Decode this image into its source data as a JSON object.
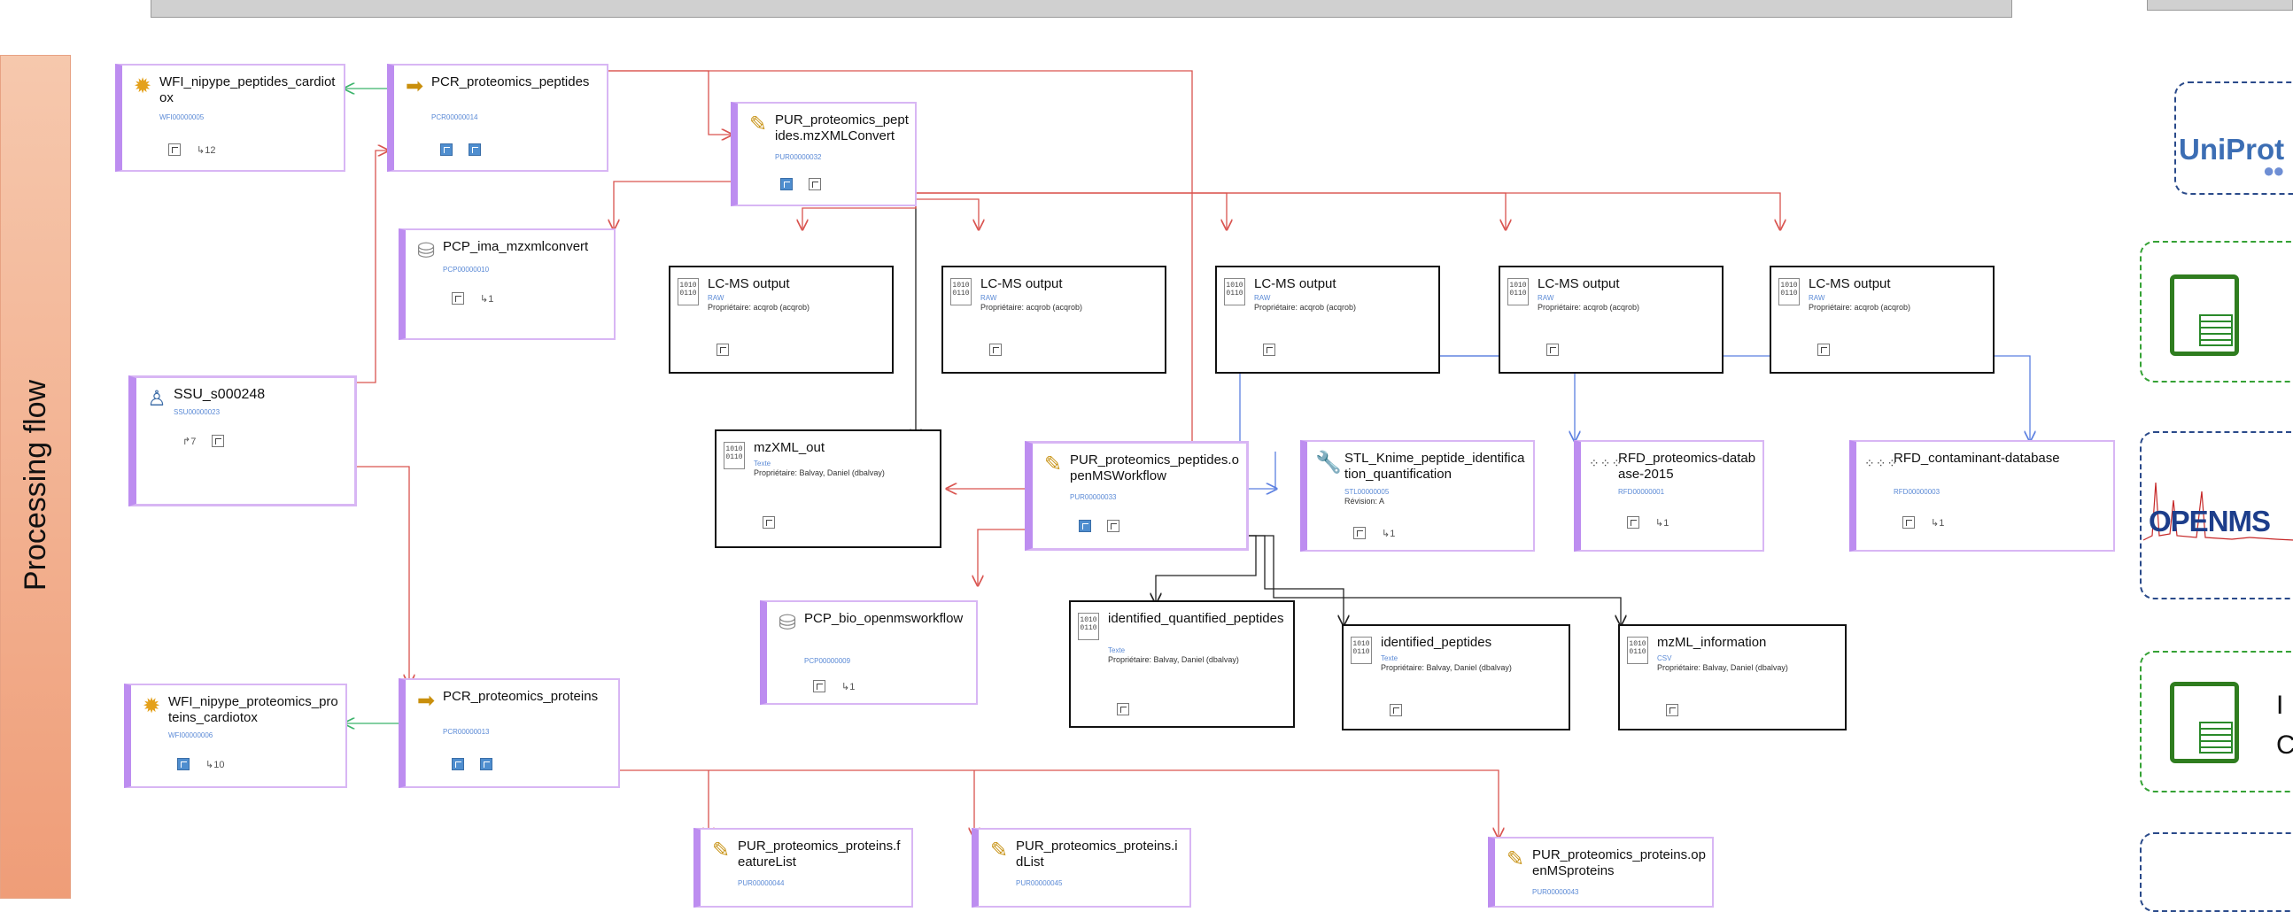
{
  "side_label": "Processing flow",
  "nodes": {
    "wfi_peptides": {
      "title": "WFI_nipype_peptides_cardiotox",
      "code": "WFI00000005",
      "count": "12"
    },
    "pcr_peptides": {
      "title": "PCR_proteomics_peptides",
      "code": "PCR00000014"
    },
    "pur_mzxml": {
      "title": "PUR_proteomics_peptides.mzXMLConvert",
      "code": "PUR00000032"
    },
    "pcp_ima": {
      "title": "PCP_ima_mzxmlconvert",
      "code": "PCP00000010",
      "count": "1"
    },
    "lcms1": {
      "title": "LC-MS output",
      "type": "RAW",
      "owner": "Propriétaire: acqrob (acqrob)"
    },
    "lcms2": {
      "title": "LC-MS output",
      "type": "RAW",
      "owner": "Propriétaire: acqrob (acqrob)"
    },
    "lcms3": {
      "title": "LC-MS output",
      "type": "RAW",
      "owner": "Propriétaire: acqrob (acqrob)"
    },
    "lcms4": {
      "title": "LC-MS output",
      "type": "RAW",
      "owner": "Propriétaire: acqrob (acqrob)"
    },
    "lcms5": {
      "title": "LC-MS output",
      "type": "RAW",
      "owner": "Propriétaire: acqrob (acqrob)"
    },
    "ssu": {
      "title": "SSU_s000248",
      "code": "SSU00000023",
      "count": "7"
    },
    "mzxml_out": {
      "title": "mzXML_out",
      "type": "Texte",
      "owner": "Propriétaire: Balvay, Daniel (dbalvay)"
    },
    "pur_openms": {
      "title": "PUR_proteomics_peptides.openMSWorkflow",
      "code": "PUR00000033"
    },
    "stl_knime": {
      "title": "STL_Knime_peptide_identification_quantification",
      "code": "STL00000005",
      "revision": "Révision: A",
      "count": "1"
    },
    "rfd_db2015": {
      "title": "RFD_proteomics-database-2015",
      "code": "RFD00000001",
      "count": "1"
    },
    "rfd_contam": {
      "title": "RFD_contaminant-database",
      "code": "RFD00000003",
      "count": "1"
    },
    "pcp_bio": {
      "title": "PCP_bio_openmsworkflow",
      "code": "PCP00000009",
      "count": "1"
    },
    "identified_quant": {
      "title": "identified_quantified_peptides",
      "type": "Texte",
      "owner": "Propriétaire: Balvay, Daniel (dbalvay)"
    },
    "identified_pep": {
      "title": "identified_peptides",
      "type": "Texte",
      "owner": "Propriétaire: Balvay, Daniel (dbalvay)"
    },
    "mzml_info": {
      "title": "mzML_information",
      "type": "CSV",
      "owner": "Propriétaire: Balvay, Daniel (dbalvay)"
    },
    "wfi_proteins": {
      "title": "WFI_nipype_proteomics_proteins_cardiotox",
      "code": "WFI00000006",
      "count": "10"
    },
    "pcr_proteins": {
      "title": "PCR_proteomics_proteins",
      "code": "PCR00000013"
    },
    "pur_featurelist": {
      "title": "PUR_proteomics_proteins.featureList",
      "code": "PUR00000044"
    },
    "pur_idlist": {
      "title": "PUR_proteomics_proteins.idList",
      "code": "PUR00000045"
    },
    "pur_openmsproteins": {
      "title": "PUR_proteomics_proteins.openMSproteins",
      "code": "PUR00000043"
    }
  },
  "logos": {
    "uniprot": "UniProt",
    "openms": "OPENMS",
    "calc2_fragment_1": "I",
    "calc2_fragment_2": "C"
  },
  "colors": {
    "edge_red": "#d9534f",
    "edge_blue": "#5b7fe0",
    "edge_green": "#3bb36b",
    "edge_black": "#222222",
    "node_border": "#bd8df0",
    "side_bg": "#f2a682"
  }
}
